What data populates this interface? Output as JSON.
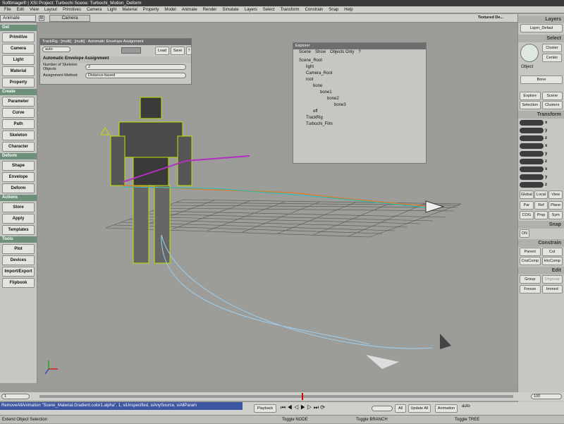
{
  "window": {
    "title": "SoftImage® | XSI Project: Turbochi   Scene: Turbochi_Motion_Deform"
  },
  "menu": [
    "File",
    "Edit",
    "View",
    "Layout",
    "Primitives",
    "Camera",
    "Light",
    "Material",
    "Property",
    "Model",
    "Animate",
    "Render",
    "Simulate",
    "Layers",
    "Select",
    "Transform",
    "Constrain",
    "Snap",
    "Help"
  ],
  "toolbar": {
    "mode": "Animate",
    "camera": "Camera",
    "display_mode": "Textured De..."
  },
  "left": {
    "sections": [
      {
        "title": "Get",
        "items": [
          "Primitive",
          "Camera",
          "Light",
          "Material",
          "Property"
        ]
      },
      {
        "title": "Create",
        "items": [
          "Parameter",
          "Curve",
          "Path",
          "Skeleton",
          "Character"
        ]
      },
      {
        "title": "Deform",
        "items": [
          "Shape",
          "Envelope",
          "Deform"
        ]
      },
      {
        "title": "Actions",
        "items": [
          "Store",
          "Apply",
          "Templates"
        ]
      },
      {
        "title": "Tools",
        "items": [
          "Plot",
          "Devices",
          "Import/Export",
          "Flipbook"
        ]
      }
    ]
  },
  "trackrig": {
    "title": "TrackRig : [multi] : [multi] : Automatic Envelope Assignment",
    "preset": "auto",
    "load": "Load",
    "save": "Save",
    "help": "?",
    "section": "Automatic Envelope Assignment",
    "num_label": "Number of Skeleton Objects",
    "num_value": "2",
    "method_label": "Assignment Method",
    "method_value": "Distance-based"
  },
  "explorer": {
    "title": "Explorer",
    "scene": "Scene",
    "show": "Show",
    "objects_only": "Objects Only",
    "help": "?",
    "nodes": [
      {
        "label": "Scene_Root",
        "indent": 0
      },
      {
        "label": "light",
        "indent": 1
      },
      {
        "label": "Camera_Root",
        "indent": 1
      },
      {
        "label": "root",
        "indent": 1
      },
      {
        "label": "bone",
        "indent": 2
      },
      {
        "label": "bone1",
        "indent": 3
      },
      {
        "label": "bone2",
        "indent": 4
      },
      {
        "label": "bone3",
        "indent": 5
      },
      {
        "label": "eff",
        "indent": 2
      },
      {
        "label": "TrackRig",
        "indent": 1
      },
      {
        "label": "Turbochi_Film",
        "indent": 1
      }
    ]
  },
  "right": {
    "layers": "Layers",
    "layer_default": "Layer_Defaul",
    "select": "Select",
    "cluster": "Cluster",
    "center": "Center",
    "object": "Object",
    "bone": "Bone",
    "explore": "Explore",
    "scene": "Scene",
    "selection": "Selection",
    "clusters": "Clusters",
    "transform": "Transform",
    "axes": [
      "x",
      "y",
      "z",
      "x",
      "y",
      "z",
      "x",
      "y",
      "z"
    ],
    "global": "Global",
    "local": "Local",
    "view": "View",
    "par": "Par",
    "ref": "Ref",
    "plane": "Plane",
    "cog": "COG",
    "prop": "Prop",
    "sym": "Sym",
    "snap": "Snap",
    "on": "ON",
    "constrain": "Constrain",
    "parent": "Parent",
    "cut": "Cut",
    "cnscomp": "CnsComp",
    "hrccomp": "HrcComp",
    "edit": "Edit",
    "group": "Group",
    "ungroup": "Ungroup",
    "freeze": "Freeze",
    "immed": "Immed"
  },
  "timeline": {
    "start": "1",
    "end": "100",
    "frame": "56"
  },
  "playback": {
    "playback": "Playback",
    "all": "All",
    "update_all": "Update All",
    "animation": "Animation",
    "auto": "auto"
  },
  "command": "RemoveAllAnimation \"Scene_Material.Gradient.color1.alpha\", 1, siUnspecified, siAnySource, siAllParam",
  "status": {
    "left": "Extend Object Selection",
    "mid": "Toggle NODE",
    "mid2": "Toggle BRANCH",
    "right": "Toggle TREE"
  },
  "colors": {
    "section": "#6e8f7a",
    "command": "#3c55a0"
  }
}
